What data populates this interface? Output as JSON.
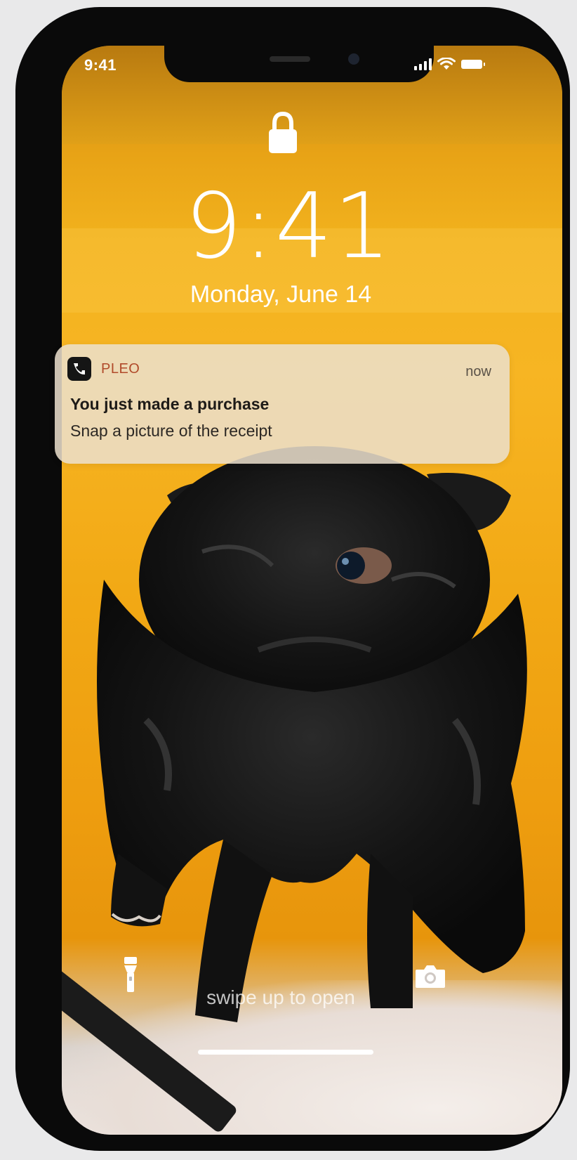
{
  "status_bar": {
    "time": "9:41"
  },
  "lock_screen": {
    "time": "9:41",
    "date": "Monday, June 14",
    "swipe_hint": "swipe up to open"
  },
  "notification": {
    "app_name": "PLEO",
    "time": "now",
    "title": "You just made a purchase",
    "body": "Snap a picture of the receipt"
  },
  "icons": {
    "lock": "lock-icon",
    "flashlight": "flashlight-icon",
    "camera": "camera-icon",
    "signal": "cellular-signal-icon",
    "wifi": "wifi-icon",
    "battery": "battery-icon",
    "app": "pleo-app-icon"
  },
  "colors": {
    "wallpaper": "#f2b21e",
    "notification_bg": "#ebe0cd",
    "app_name": "#b14a2a"
  }
}
